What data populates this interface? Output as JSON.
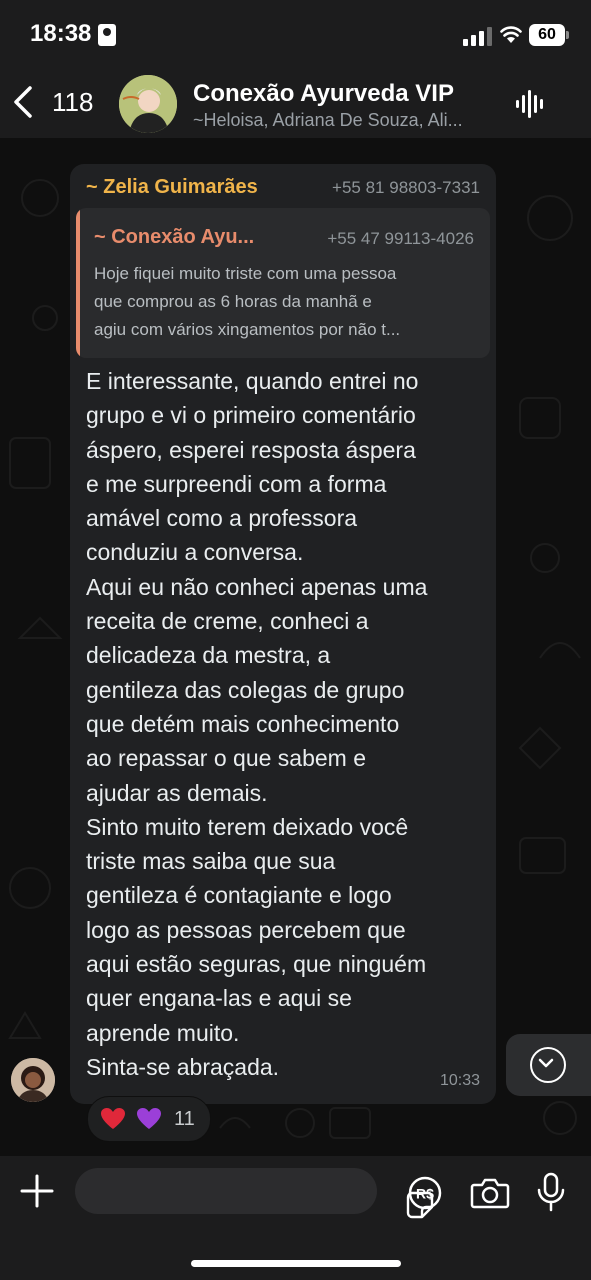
{
  "status_bar": {
    "time": "18:38",
    "battery": "60"
  },
  "header": {
    "back_count": "118",
    "title": "Conexão Ayurveda VIP",
    "subtitle": "~Heloisa, Adriana De Souza, Ali..."
  },
  "message": {
    "sender": "~ Zelia Guimarães",
    "sender_phone": "+55 81 98803-7331",
    "quote": {
      "name": "~ Conexão Ayu...",
      "phone": "+55 47 99113-4026",
      "lines": [
        "Hoje fiquei muito triste com uma pessoa",
        "que comprou as 6 horas da manhã e",
        "agiu com vários xingamentos por não t..."
      ]
    },
    "lines": [
      "E interessante, quando entrei no",
      "grupo e vi o primeiro comentário",
      "áspero,  esperei resposta áspera",
      "e me surpreendi com a forma",
      "amável como a professora",
      "conduziu a conversa.",
      "Aqui eu não conheci apenas uma",
      "receita de creme, conheci a",
      "delicadeza da mestra, a",
      "gentileza das colegas de grupo",
      "que detém mais conhecimento",
      "ao repassar o que sabem e",
      "ajudar as demais.",
      "Sinto muito terem deixado você",
      "triste mas saiba que sua",
      "gentileza é contagiante e logo",
      "logo as pessoas percebem que",
      "aqui estão seguras, que ninguém",
      "quer engana-las e aqui se",
      "aprende muito.",
      "Sinta-se abraçada."
    ],
    "time": "10:33",
    "reactions": {
      "emojis": [
        "red-heart",
        "purple-heart"
      ],
      "count": "11"
    }
  },
  "input_bar": {
    "icons": [
      "plus-icon",
      "sticker-icon",
      "pix-icon",
      "camera-icon",
      "mic-icon"
    ],
    "pix_label": "R$"
  },
  "colors": {
    "sender": "#f0b44a",
    "quote_accent": "#e88c6c",
    "bubble": "#202123",
    "background": "#0b0b0b"
  }
}
